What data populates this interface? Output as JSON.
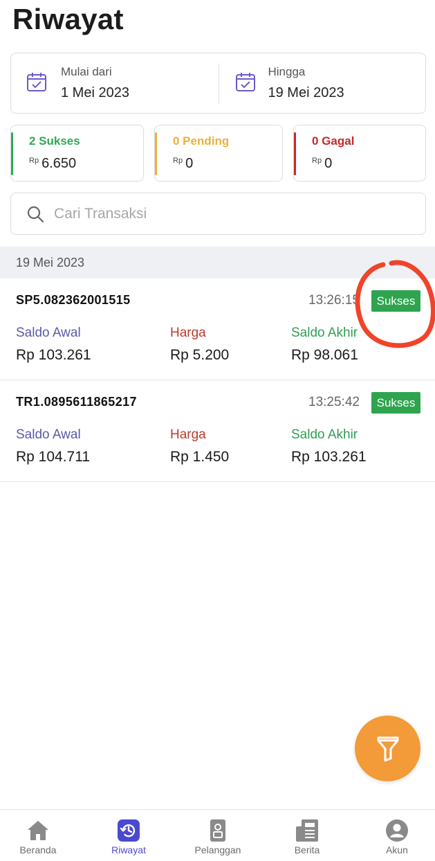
{
  "page": {
    "title": "Riwayat"
  },
  "date_range": {
    "from_label": "Mulai dari",
    "from_value": "1 Mei 2023",
    "to_label": "Hingga",
    "to_value": "19 Mei 2023"
  },
  "status_summary": [
    {
      "label": "2 Sukses",
      "currency": "Rp",
      "amount": "6.650",
      "color": "#2eaa55"
    },
    {
      "label": "0 Pending",
      "currency": "Rp",
      "amount": "0",
      "color": "#e8b23a"
    },
    {
      "label": "0 Gagal",
      "currency": "Rp",
      "amount": "0",
      "color": "#c62828"
    }
  ],
  "search": {
    "placeholder": "Cari Transaksi"
  },
  "group_date": "19 Mei 2023",
  "column_labels": {
    "saldo_awal": "Saldo Awal",
    "harga": "Harga",
    "saldo_akhir": "Saldo Akhir"
  },
  "transactions": [
    {
      "id": "SP5.082362001515",
      "time": "13:26:15",
      "status": "Sukses",
      "saldo_awal": "Rp 103.261",
      "harga": "Rp 5.200",
      "saldo_akhir": "Rp 98.061"
    },
    {
      "id": "TR1.0895611865217",
      "time": "13:25:42",
      "status": "Sukses",
      "saldo_awal": "Rp 104.711",
      "harga": "Rp 1.450",
      "saldo_akhir": "Rp 103.261"
    }
  ],
  "fab": {
    "icon": "filter-icon",
    "color": "#f29b38"
  },
  "bottom_nav": [
    {
      "label": "Beranda",
      "icon": "home-icon",
      "active": false
    },
    {
      "label": "Riwayat",
      "icon": "history-icon",
      "active": true
    },
    {
      "label": "Pelanggan",
      "icon": "contact-card-icon",
      "active": false
    },
    {
      "label": "Berita",
      "icon": "news-icon",
      "active": false
    },
    {
      "label": "Akun",
      "icon": "account-icon",
      "active": false
    }
  ],
  "colors": {
    "success_badge": "#2ea44f",
    "annotation_circle": "#f0442a",
    "nav_active": "#4a4ad0",
    "nav_inactive": "#8a8a8a"
  }
}
